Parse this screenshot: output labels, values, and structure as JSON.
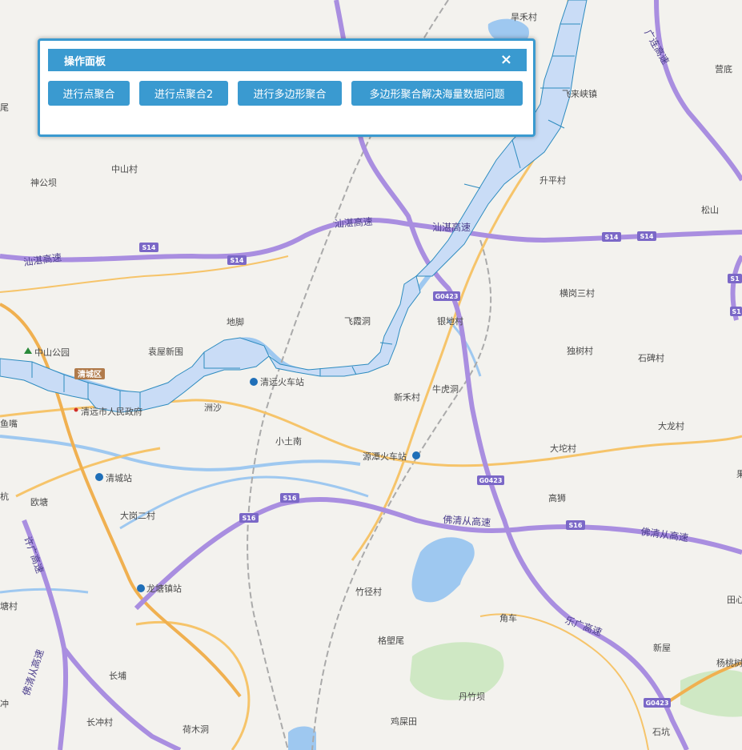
{
  "panel": {
    "title": "操作面板",
    "close": "×",
    "buttons": [
      "进行点聚合",
      "进行点聚合2",
      "进行多边形聚合",
      "多边形聚合解决海量数据问题"
    ]
  },
  "map": {
    "places": [
      "旱禾村",
      "营底",
      "飞来峡镇",
      "升平村",
      "松山",
      "中山村",
      "神公坝",
      "地脚",
      "飞霞洞",
      "横岗三村",
      "银地村",
      "中山公园",
      "袁屋新围",
      "独树村",
      "石碑村",
      "清远火车站",
      "新禾村",
      "牛虎洞",
      "清城区",
      "清远市人民政府",
      "洲沙",
      "大龙村",
      "鱼嘴",
      "小土南",
      "源潭火车站",
      "大坨村",
      "清城站",
      "欧塘",
      "大岗二村",
      "高狮",
      "龙塘镇站",
      "竹径村",
      "角车",
      "格塱尾",
      "新屋",
      "杨桃树",
      "丹竹坝",
      "长埔",
      "长冲村",
      "荷木洞",
      "鸡屎田",
      "石坑",
      "田心",
      "冲",
      "塘村",
      "杭",
      "尾",
      "果"
    ],
    "highways": [
      "汕湛高速",
      "汕湛高速",
      "汕湛高速",
      "广连高速",
      "佛清从高速",
      "佛清从高速",
      "乐广高速",
      "佛清从高速",
      "许广高速"
    ],
    "shields": [
      "S14",
      "S14",
      "S14",
      "S14",
      "G0423",
      "G0423",
      "G0423",
      "S16",
      "S16",
      "S16",
      "S1",
      "S1"
    ]
  },
  "colors": {
    "panel_accent": "#3a9ad0",
    "water": "#9ec8f0",
    "polygon_fill": "#c9dcf6",
    "polygon_stroke": "#2d8bbf",
    "expressway": "#a98ee0",
    "major_road": "#f6c46a",
    "land": "#f3f2ee",
    "park": "#cfe8c4"
  }
}
